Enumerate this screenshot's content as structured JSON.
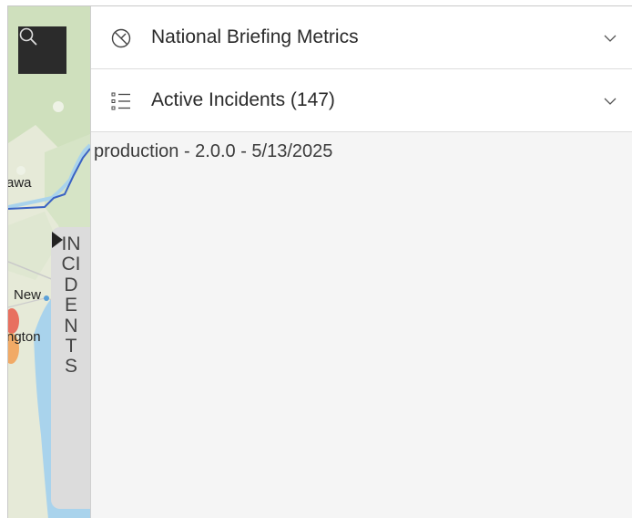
{
  "map": {
    "labels": {
      "ottawa": "awa",
      "new_york": "New",
      "washington": "ngton"
    }
  },
  "incidents_tab": {
    "label": "INCIDENTS"
  },
  "panel": {
    "sections": [
      {
        "title": "National Briefing Metrics",
        "icon": "gauge-icon"
      },
      {
        "title": "Active Incidents (147)",
        "icon": "list-icon"
      }
    ],
    "version_text": "production - 2.0.0 - 5/13/2025"
  },
  "colors": {
    "accent_water": "#a9d3ec",
    "border_line": "#3a62c4",
    "fire_red": "#e85a4a",
    "fire_orange": "#f2a35a"
  }
}
